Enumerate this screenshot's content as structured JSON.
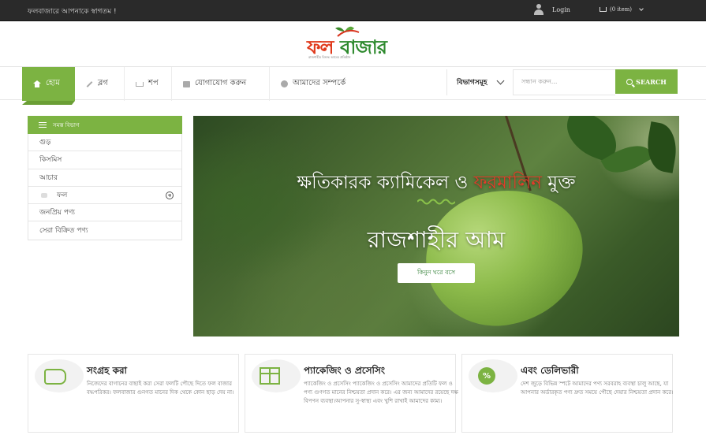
{
  "topbar": {
    "welcome": "ফলবাজারে আপনাকে স্বাগতম !",
    "login": "Login",
    "cart": "(0 item)"
  },
  "logo": {
    "word1": "ফল",
    "word2": "বাজার",
    "tagline": "রাজশাহীর বিশুদ্ধ আমের প্রতিষ্ঠান"
  },
  "nav": {
    "items": [
      {
        "label": "হোম",
        "icon": "home-icon"
      },
      {
        "label": "ব্লগ",
        "icon": "pencil-icon"
      },
      {
        "label": "শপ",
        "icon": "cart-icon"
      },
      {
        "label": "যোগাযোগ করুন",
        "icon": "contact-card-icon"
      },
      {
        "label": "আমাদের সম্পর্কে",
        "icon": "info-icon"
      }
    ],
    "category_select": "বিভাগসমূহ",
    "search_placeholder": "সন্ধান করুন...",
    "search_button": "SEARCH"
  },
  "sidebar": {
    "heading": "সমস্ত বিভাগ",
    "items": [
      {
        "label": "গুড়"
      },
      {
        "label": "কিসমিস"
      },
      {
        "label": "আচার"
      },
      {
        "label": "ফল"
      },
      {
        "label": "জনপ্রিয় পণ্য"
      },
      {
        "label": "সেরা বিক্রিত পণ্য"
      }
    ]
  },
  "hero": {
    "line1_part1": "ক্ষতিকারক ক্যামিকেল ও ",
    "line1_red": "ফরমালিন",
    "line1_part2": " মুক্ত",
    "line2": "রাজশাহীর আম",
    "button": "কিনুন ঘরে বসে"
  },
  "features": [
    {
      "title": "সংগ্রহ করা",
      "desc": "নিজেদের বাগানের বাছাই করা সেরা ফলটি পৌছে দিতে ফল বাজার বদ্ধপরিকর। ফলবাজার গুনগত মানের দিক থেকে কোন ছাড় দেয় না।"
    },
    {
      "title": "প্যাকেজিং ও প্রসেসিং",
      "desc": "প্যাকেজিং ও প্রসেসিং প্যাকেজিং ও প্রসেসিং আমাদের প্রতিটি ফল ও পণ্য গুণগত মানের নিশ্চয়তা প্রদান করে। এর জন্য আমাদের রয়েছে দক্ষ বিপণন ব্যবস্থা।আপনার সু-স্বাস্থ্য এবং খুশি রাখাই আমাদের কাম্য।"
    },
    {
      "title": "এবং ডেলিভারী",
      "desc": "দেশ জুড়ে বিভিন্ন স্পটে আমাদের পণ্য সরবরাহ ব্যবস্থা চালু আছে, যা আপনার অর্ডারকৃত পণ্য দ্রুত সময়ে পৌছে দেয়ার নিশ্চয়তা প্রদান করে।"
    }
  ],
  "colors": {
    "accent": "#7cb342",
    "topbar": "#2a2a2a",
    "hero_red": "#e53b2a"
  }
}
